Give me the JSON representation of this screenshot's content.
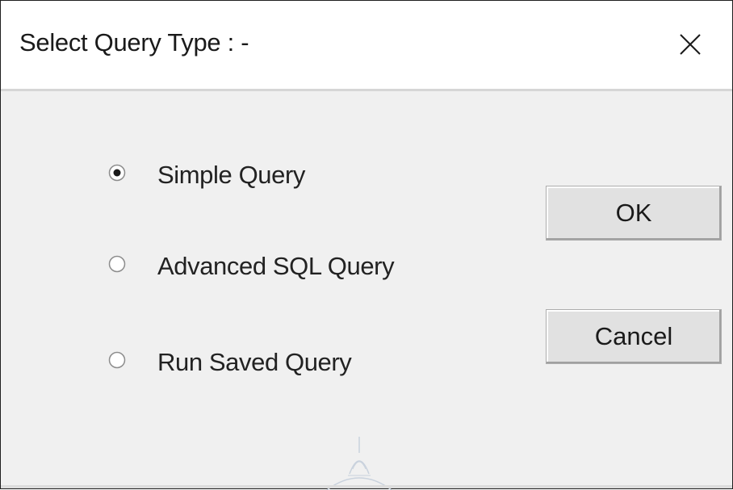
{
  "dialog": {
    "title": "Select Query Type : -",
    "close_icon": "close-icon"
  },
  "options": [
    {
      "label": "Simple Query",
      "selected": true
    },
    {
      "label": "Advanced SQL Query",
      "selected": false
    },
    {
      "label": "Run Saved Query",
      "selected": false
    }
  ],
  "buttons": {
    "ok_label": "OK",
    "cancel_label": "Cancel"
  },
  "colors": {
    "titlebar_bg": "#ffffff",
    "client_bg": "#f0f0f0",
    "button_bg": "#e1e1e1",
    "text": "#222222"
  }
}
